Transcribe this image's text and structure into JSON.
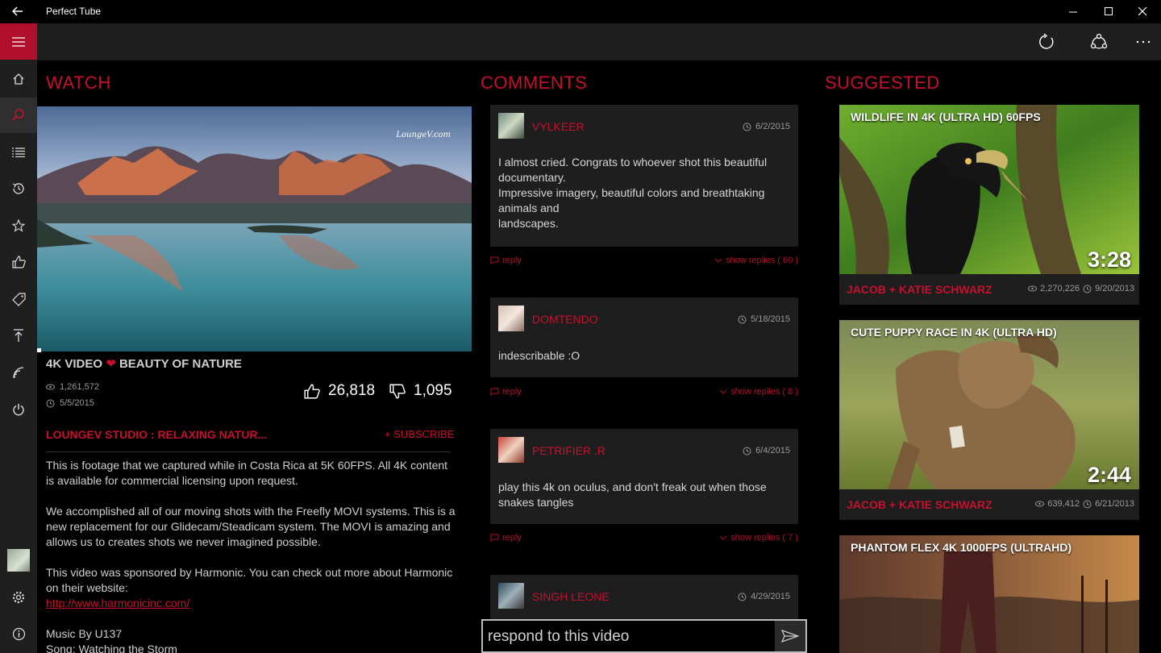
{
  "app": {
    "title": "Perfect Tube"
  },
  "colors": {
    "accent": "#c5102e",
    "panel": "#1e1e1e",
    "nav": "#1f1f1f"
  },
  "nav": {
    "items": [
      {
        "icon": "home-icon"
      },
      {
        "icon": "search-icon"
      },
      {
        "icon": "list-icon"
      },
      {
        "icon": "history-icon"
      },
      {
        "icon": "star-icon"
      },
      {
        "icon": "thumbs-up-icon"
      },
      {
        "icon": "tag-icon"
      },
      {
        "icon": "upload-icon"
      },
      {
        "icon": "broadcast-icon"
      },
      {
        "icon": "power-icon"
      },
      {
        "icon": "settings-icon"
      },
      {
        "icon": "info-icon"
      }
    ]
  },
  "sections": {
    "watch": "WATCH",
    "comments": "COMMENTS",
    "suggested": "SUGGESTED"
  },
  "video": {
    "watermark": "LoungeV.com",
    "title_part1": "4K VIDEO",
    "title_part2": "BEAUTY OF NATURE",
    "views": "1,261,572",
    "date": "5/5/2015",
    "likes": "26,818",
    "dislikes": "1,095",
    "channel": "LOUNGEV STUDIO : RELAXING NATUR...",
    "subscribe": "+ SUBSCRIBE",
    "desc1": "This is footage that we captured while in Costa Rica at 5K 60FPS. All 4K content is available for commercial licensing upon request.",
    "desc2": "We accomplished all of our moving shots with the Freefly MOVI systems. This is a new replacement for our Glidecam/Steadicam system. The MOVI is amazing and allows us to creates shots we never imagined possible.",
    "desc3": "This video was sponsored by Harmonic. You can check out more about Harmonic on their website:",
    "link": "http://www.harmonicinc.com/",
    "music1": "Music By U137",
    "music2": "Song: Watching the Storm"
  },
  "comments": [
    {
      "user": "VYLKEER",
      "date": "6/2/2015",
      "text": "I almost cried. Congrats to whoever shot this beautiful documentary.\nImpressive imagery, beautiful colors and breathtaking animals and\nlandscapes.",
      "reply": "reply",
      "replies": "show replies ( 60 )"
    },
    {
      "user": "DOMTENDO",
      "date": "5/18/2015",
      "text": "indescribable :O",
      "reply": "reply",
      "replies": "show replies ( 8 )"
    },
    {
      "user": "PETRIFIER .R",
      "date": "6/4/2015",
      "text": "play this 4k on oculus, and don't freak out when those snakes tangles",
      "reply": "reply",
      "replies": "show replies ( 7 )"
    },
    {
      "user": "SINGH LEONE",
      "date": "4/29/2015"
    }
  ],
  "respond": {
    "placeholder": "respond to this video"
  },
  "suggested": [
    {
      "title": "WILDLIFE IN 4K (ULTRA HD) 60FPS",
      "duration": "3:28",
      "channel": "JACOB + KATIE SCHWARZ",
      "views": "2,270,226",
      "date": "9/20/2013"
    },
    {
      "title": "CUTE PUPPY RACE IN 4K (ULTRA HD)",
      "duration": "2:44",
      "channel": "JACOB + KATIE SCHWARZ",
      "views": "639,412",
      "date": "6/21/2013"
    },
    {
      "title": "PHANTOM FLEX 4K 1000FPS (ULTRAHD)"
    }
  ]
}
